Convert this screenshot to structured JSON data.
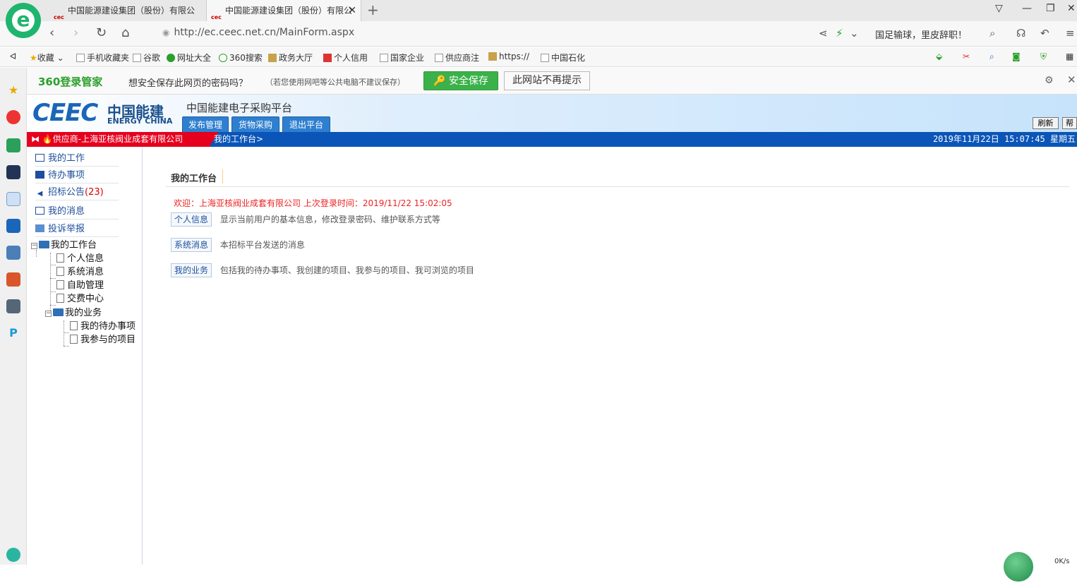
{
  "browser": {
    "tabs": [
      {
        "favicon": "cec",
        "title": "中国能源建设集团（股份）有限公"
      },
      {
        "favicon": "cec",
        "title": "中国能源建设集团（股份）有限公"
      }
    ],
    "url": "http://ec.ceec.net.cn/MainForm.aspx",
    "news": "国足输球，里皮辞职！",
    "bookmarks": [
      "收藏",
      "手机收藏夹",
      "谷歌",
      "网址大全",
      "360搜索",
      "政务大厅",
      "个人信用",
      "国家企业",
      "供应商注",
      "https://",
      "中国石化"
    ],
    "icons": [
      "browser-logo-icon",
      "back-icon",
      "forward-icon",
      "refresh-icon",
      "home-icon",
      "share-icon",
      "bolt-icon",
      "search-icon",
      "headphones-icon",
      "undo-icon",
      "menu-icon"
    ]
  },
  "password_bar": {
    "brand": "360登录管家",
    "question": "想安全保存此网页的密码吗？",
    "note": "（若您使用网吧等公共电脑不建议保存）",
    "save_label": "安全保存",
    "never_label": "此网站不再提示"
  },
  "header": {
    "logo_text": "CEEC",
    "logo_cn": "中国能建",
    "logo_en": "ENERGY CHINA",
    "platform_title": "中国能建电子采购平台",
    "nav_tabs": [
      "发布管理",
      "货物采购",
      "退出平台"
    ],
    "refresh_label": "刷新",
    "help_label": "帮"
  },
  "strip": {
    "supplier": "供应商-上海亚核阀业成套有限公司",
    "breadcrumb": "我的工作台>",
    "datetime": "2019年11月22日 15:07:45 星期五"
  },
  "menu": {
    "items": [
      {
        "label": "我的工作",
        "count": ""
      },
      {
        "label": "待办事项",
        "count": ""
      },
      {
        "label": "招标公告",
        "count": "(23)"
      },
      {
        "label": "我的消息",
        "count": ""
      },
      {
        "label": "投诉举报",
        "count": ""
      }
    ],
    "tree": {
      "root": "我的工作台",
      "children": [
        "个人信息",
        "系统消息",
        "自助管理",
        "交费中心"
      ],
      "sub_root": "我的业务",
      "sub_children": [
        "我的待办事项",
        "我参与的项目"
      ]
    }
  },
  "main": {
    "title": "我的工作台",
    "welcome": "欢迎：上海亚核阀业成套有限公司  上次登录时间：2019/11/22 15:02:05",
    "rows": [
      {
        "label": "个人信息",
        "desc": "显示当前用户的基本信息，修改登录密码、维护联系方式等"
      },
      {
        "label": "系统消息",
        "desc": "本招标平台发送的消息"
      },
      {
        "label": "我的业务",
        "desc": "包括我的待办事项、我创建的项目、我参与的项目、我可浏览的项目"
      }
    ]
  },
  "speed_widget": {
    "text": "0K/s"
  },
  "colors": {
    "brand_blue": "#1a66b8",
    "strip_red": "#e5001e",
    "strip_blue": "#0b55b8",
    "welcome_red": "#e22",
    "save_green": "#3bb14a"
  }
}
